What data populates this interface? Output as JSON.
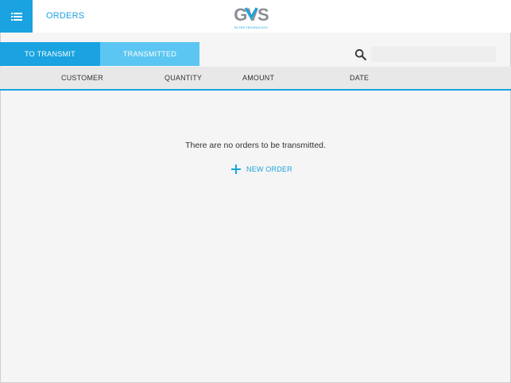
{
  "header": {
    "menu_icon": "list-icon",
    "title": "ORDERS",
    "logo_text": "GVS",
    "logo_subtext": "FILTER TECHNOLOGY"
  },
  "tabs": [
    {
      "label": "TO TRANSMIT",
      "active": true
    },
    {
      "label": "TRANSMITTED",
      "active": false
    }
  ],
  "search": {
    "icon": "search-icon",
    "value": "",
    "placeholder": ""
  },
  "table": {
    "columns": [
      "CUSTOMER",
      "QUANTITY",
      "AMOUNT",
      "DATE"
    ]
  },
  "empty_state": {
    "message": "There are no orders to be transmitted.",
    "action_label": "NEW ORDER",
    "action_icon": "plus-icon"
  },
  "colors": {
    "accent": "#1aa3e0",
    "accent_light": "#5cc6f2",
    "background": "#f5f5f5",
    "header_bg": "#e8e8e8"
  }
}
